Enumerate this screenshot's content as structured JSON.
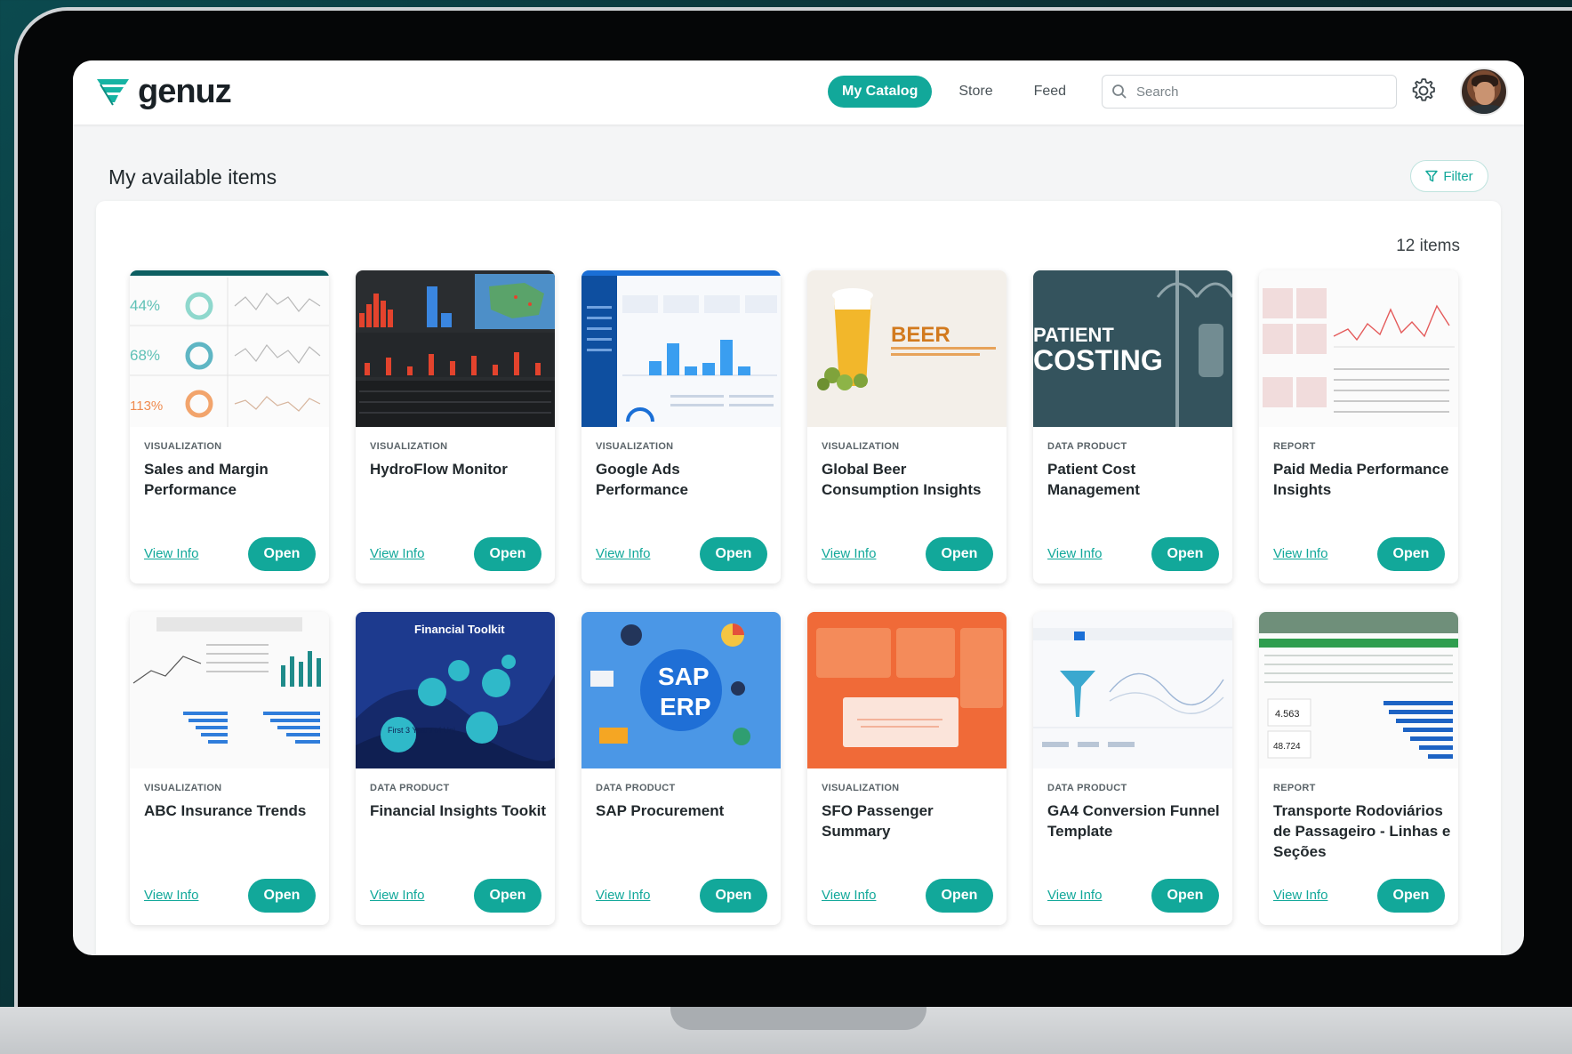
{
  "app": {
    "brand": "genuz",
    "colors": {
      "accent": "#12a89a",
      "text": "#22292d"
    }
  },
  "nav": {
    "items": [
      {
        "label": "My Catalog",
        "active": true
      },
      {
        "label": "Store",
        "active": false
      },
      {
        "label": "Feed",
        "active": false
      }
    ]
  },
  "search": {
    "placeholder": "Search",
    "value": "",
    "icon": "search-icon"
  },
  "settings": {
    "icon": "gear-icon"
  },
  "page": {
    "title": "My available items",
    "filter_label": "Filter",
    "count_label": "12 items"
  },
  "cards": [
    {
      "category": "VISUALIZATION",
      "title": "Sales and Margin Performance",
      "view_label": "View Info",
      "open_label": "Open",
      "thumb_text": [
        "44%",
        "68%",
        "113%"
      ]
    },
    {
      "category": "VISUALIZATION",
      "title": "HydroFlow Monitor",
      "view_label": "View Info",
      "open_label": "Open"
    },
    {
      "category": "VISUALIZATION",
      "title": "Google Ads Performance",
      "view_label": "View Info",
      "open_label": "Open"
    },
    {
      "category": "VISUALIZATION",
      "title": "Global Beer Consumption Insights",
      "view_label": "View Info",
      "open_label": "Open",
      "thumb_text": [
        "BEER"
      ]
    },
    {
      "category": "DATA PRODUCT",
      "title": "Patient Cost Management",
      "view_label": "View Info",
      "open_label": "Open",
      "thumb_text": [
        "PATIENT",
        "COSTING"
      ]
    },
    {
      "category": "REPORT",
      "title": "Paid Media Performance Insights",
      "view_label": "View Info",
      "open_label": "Open"
    },
    {
      "category": "VISUALIZATION",
      "title": "ABC Insurance Trends",
      "view_label": "View Info",
      "open_label": "Open"
    },
    {
      "category": "DATA PRODUCT",
      "title": "Financial Insights Tookit",
      "view_label": "View Info",
      "open_label": "Open",
      "thumb_text": [
        "Financial Toolkit",
        "First 3 Years of Uni"
      ]
    },
    {
      "category": "DATA PRODUCT",
      "title": "SAP Procurement",
      "view_label": "View Info",
      "open_label": "Open",
      "thumb_text": [
        "SAP",
        "ERP"
      ]
    },
    {
      "category": "VISUALIZATION",
      "title": "SFO Passenger Summary",
      "view_label": "View Info",
      "open_label": "Open"
    },
    {
      "category": "DATA PRODUCT",
      "title": "GA4 Conversion Funnel Template",
      "view_label": "View Info",
      "open_label": "Open"
    },
    {
      "category": "REPORT",
      "title": "Transporte Rodoviários de Passageiro - Linhas e Seções",
      "view_label": "View Info",
      "open_label": "Open",
      "thumb_text": [
        "4.563",
        "48.724"
      ]
    }
  ]
}
